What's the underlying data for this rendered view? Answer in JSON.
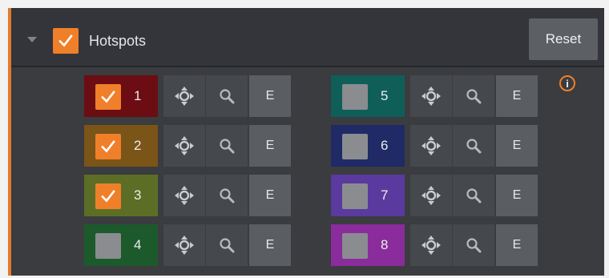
{
  "header": {
    "title": "Hotspots",
    "reset_label": "Reset",
    "enabled": true
  },
  "info_label": "i",
  "hotspots": [
    {
      "number": "1",
      "checked": true,
      "color": "#6b0d12"
    },
    {
      "number": "2",
      "checked": true,
      "color": "#7b5418"
    },
    {
      "number": "3",
      "checked": true,
      "color": "#5c6e26"
    },
    {
      "number": "4",
      "checked": false,
      "color": "#1c5a2c"
    },
    {
      "number": "5",
      "checked": false,
      "color": "#0f5f58"
    },
    {
      "number": "6",
      "checked": false,
      "color": "#1f2a66"
    },
    {
      "number": "7",
      "checked": false,
      "color": "#5a3a9e"
    },
    {
      "number": "8",
      "checked": false,
      "color": "#8a2c9c"
    }
  ],
  "edit_label": "E",
  "icons": {
    "collapse": "triangle-down-icon",
    "move": "move-arrows-icon",
    "zoom": "magnifier-icon",
    "info": "info-icon",
    "check": "checkmark-icon"
  },
  "colors": {
    "accent": "#f07f2a",
    "panel": "#3a3c40",
    "button": "#45484d"
  }
}
